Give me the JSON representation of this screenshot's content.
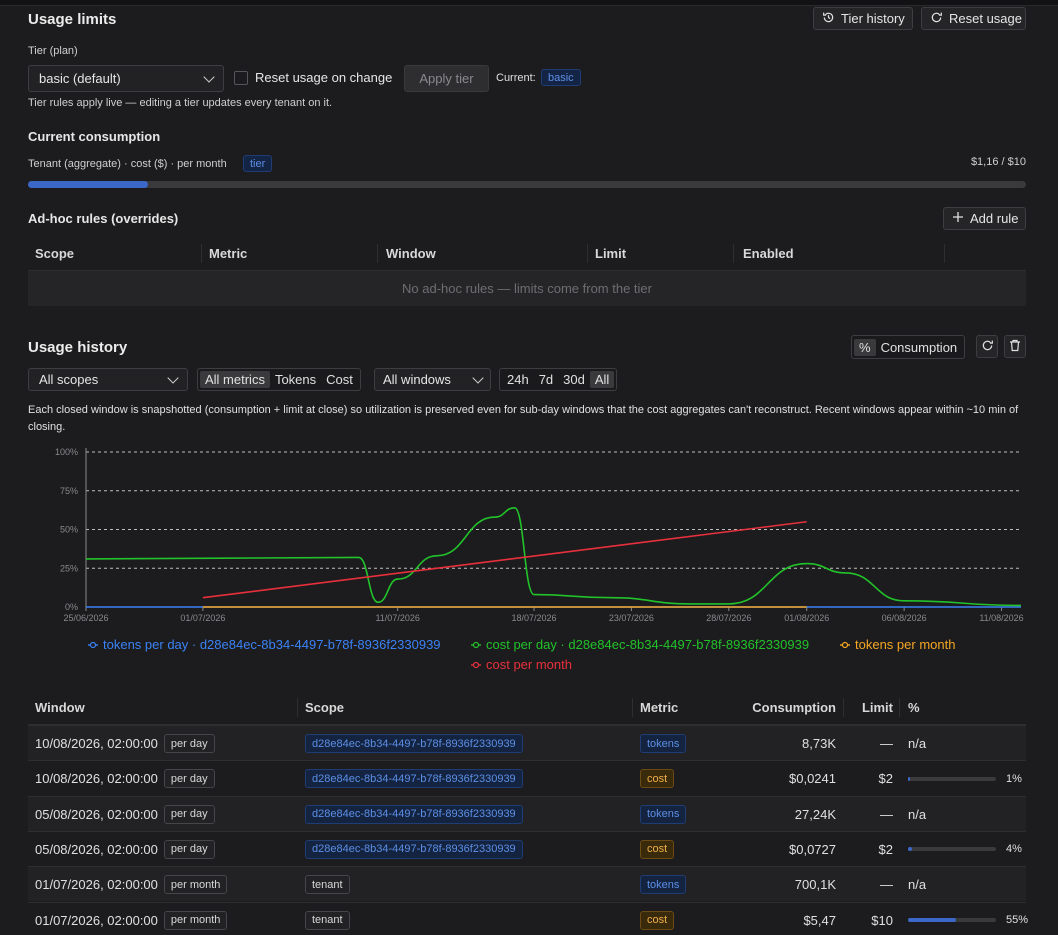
{
  "colors": {
    "blue": "#3b82f6",
    "green": "#22c22a",
    "orange": "#f5a623",
    "red": "#e8303c",
    "accent": "#3b67c9"
  },
  "usage_limits": {
    "title": "Usage limits",
    "tier_history_label": "Tier history",
    "reset_usage_label": "Reset usage",
    "tier_label": "Tier (plan)",
    "tier_value": "basic (default)",
    "reset_on_change_label": "Reset usage on change",
    "reset_on_change_checked": false,
    "apply_tier_label": "Apply tier",
    "current_label": "Current:",
    "current_value": "basic",
    "note": "Tier rules apply live — editing a tier updates every tenant on it."
  },
  "consumption": {
    "title": "Current consumption",
    "subject": "Tenant (aggregate) · cost ($) · per month",
    "badge": "tier",
    "amount": "$1,16 / $10",
    "progress_fraction": 0.12
  },
  "adhoc": {
    "title": "Ad-hoc rules (overrides)",
    "add_rule_label": "Add rule",
    "columns": [
      "Scope",
      "Metric",
      "Window",
      "Limit",
      "Enabled"
    ],
    "empty_text": "No ad-hoc rules — limits come from the tier"
  },
  "history": {
    "title": "Usage history",
    "view_toggle": [
      "%",
      "Consumption"
    ],
    "view_active": 0,
    "scope_filter": "All scopes",
    "metric_filter": [
      "All metrics",
      "Tokens",
      "Cost"
    ],
    "metric_active": 0,
    "window_filter": "All windows",
    "range_filter": [
      "24h",
      "7d",
      "30d",
      "All"
    ],
    "range_active": 3,
    "description": "Each closed window is snapshotted (consumption + limit at close) so utilization is preserved even for sub-day windows that the cost aggregates can't reconstruct. Recent windows appear within ~10 min of closing."
  },
  "chart_data": {
    "type": "line",
    "y_ticks": [
      "0%",
      "25%",
      "50%",
      "75%",
      "100%"
    ],
    "ylim": [
      0,
      100
    ],
    "x_ticks": [
      "25/06/2026",
      "01/07/2026",
      "11/07/2026",
      "18/07/2026",
      "23/07/2026",
      "28/07/2026",
      "01/08/2026",
      "06/08/2026",
      "11/08/2026"
    ],
    "grid": true,
    "legend_position": "bottom",
    "series": [
      {
        "name": "tokens per day · d28e84ec-8b34-4497-b78f-8936f2330939",
        "color": "#3b82f6",
        "points": [
          [
            "25/06/2026",
            0
          ],
          [
            "01/07/2026",
            0
          ],
          [
            "01/08/2026",
            0
          ],
          [
            "12/08/2026",
            0
          ]
        ]
      },
      {
        "name": "cost per day · d28e84ec-8b34-4497-b78f-8936f2330939",
        "color": "#22c22a",
        "points": [
          [
            "25/06/2026",
            31
          ],
          [
            "09/07/2026",
            32
          ],
          [
            "10/07/2026",
            3
          ],
          [
            "11/07/2026",
            18
          ],
          [
            "13/07/2026",
            33
          ],
          [
            "16/07/2026",
            58
          ],
          [
            "17/07/2026",
            64
          ],
          [
            "18/07/2026",
            8
          ],
          [
            "22/07/2026",
            6
          ],
          [
            "26/07/2026",
            2
          ],
          [
            "28/07/2026",
            2
          ],
          [
            "01/08/2026",
            28
          ],
          [
            "03/08/2026",
            22
          ],
          [
            "06/08/2026",
            4
          ],
          [
            "12/08/2026",
            1
          ]
        ]
      },
      {
        "name": "tokens per month",
        "color": "#f5a623",
        "points": [
          [
            "01/07/2026",
            0
          ],
          [
            "01/08/2026",
            0
          ]
        ]
      },
      {
        "name": "cost per month",
        "color": "#e8303c",
        "points": [
          [
            "01/07/2026",
            6
          ],
          [
            "01/08/2026",
            55
          ]
        ]
      }
    ]
  },
  "history_table": {
    "columns": [
      "Window",
      "Scope",
      "Metric",
      "Consumption",
      "Limit",
      "%"
    ],
    "rows": [
      {
        "window": "10/08/2026, 02:00:00",
        "period": "per day",
        "scope": "d28e84ec-8b34-4497-b78f-8936f2330939",
        "scope_type": "id",
        "metric": "tokens",
        "consumption": "8,73K",
        "limit": "—",
        "pct_text": "n/a",
        "pct": null
      },
      {
        "window": "10/08/2026, 02:00:00",
        "period": "per day",
        "scope": "d28e84ec-8b34-4497-b78f-8936f2330939",
        "scope_type": "id",
        "metric": "cost",
        "consumption": "$0,0241",
        "limit": "$2",
        "pct_text": "1%",
        "pct": 1
      },
      {
        "window": "05/08/2026, 02:00:00",
        "period": "per day",
        "scope": "d28e84ec-8b34-4497-b78f-8936f2330939",
        "scope_type": "id",
        "metric": "tokens",
        "consumption": "27,24K",
        "limit": "—",
        "pct_text": "n/a",
        "pct": null
      },
      {
        "window": "05/08/2026, 02:00:00",
        "period": "per day",
        "scope": "d28e84ec-8b34-4497-b78f-8936f2330939",
        "scope_type": "id",
        "metric": "cost",
        "consumption": "$0,0727",
        "limit": "$2",
        "pct_text": "4%",
        "pct": 4
      },
      {
        "window": "01/07/2026, 02:00:00",
        "period": "per month",
        "scope": "tenant",
        "scope_type": "tenant",
        "metric": "tokens",
        "consumption": "700,1K",
        "limit": "—",
        "pct_text": "n/a",
        "pct": null
      },
      {
        "window": "01/07/2026, 02:00:00",
        "period": "per month",
        "scope": "tenant",
        "scope_type": "tenant",
        "metric": "cost",
        "consumption": "$5,47",
        "limit": "$10",
        "pct_text": "55%",
        "pct": 55
      }
    ]
  }
}
